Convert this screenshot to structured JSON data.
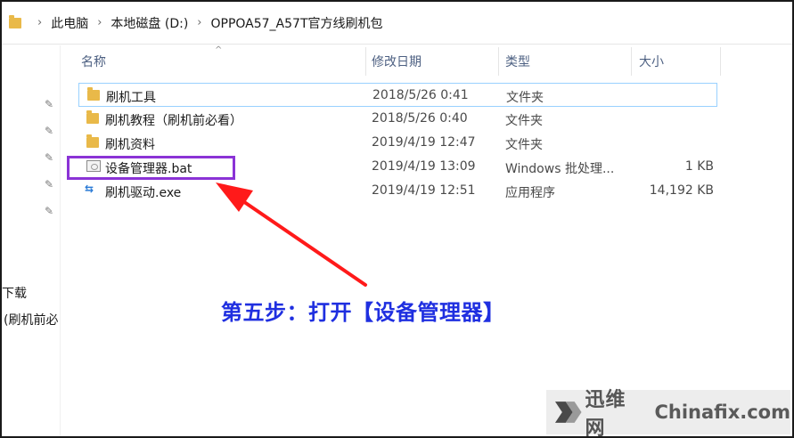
{
  "address_bar": {
    "crumbs": [
      "此电脑",
      "本地磁盘 (D:)",
      "OPPOA57_A57T官方线刷机包"
    ]
  },
  "nav": {
    "items": [
      "下载",
      "(刷机前必"
    ]
  },
  "columns": {
    "name": "名称",
    "date": "修改日期",
    "type": "类型",
    "size": "大小"
  },
  "files": [
    {
      "name": "刷机工具",
      "date": "2018/5/26 0:41",
      "type": "文件夹",
      "size": "",
      "icon": "folder-icon"
    },
    {
      "name": "刷机教程（刷机前必看）",
      "date": "2018/5/26 0:40",
      "type": "文件夹",
      "size": "",
      "icon": "folder-icon"
    },
    {
      "name": "刷机资料",
      "date": "2019/4/19 12:47",
      "type": "文件夹",
      "size": "",
      "icon": "folder-icon"
    },
    {
      "name": "设备管理器.bat",
      "date": "2019/4/19 13:09",
      "type": "Windows 批处理...",
      "size": "1 KB",
      "icon": "batch-file-icon"
    },
    {
      "name": "刷机驱动.exe",
      "date": "2019/4/19 12:51",
      "type": "应用程序",
      "size": "14,192 KB",
      "icon": "usb-exe-icon"
    }
  ],
  "annotation": {
    "step_text": "第五步：打开【设备管理器】",
    "arrow_color": "#ff1a1a",
    "box_color": "#8b33d6",
    "text_color": "#1f2fe0"
  },
  "watermark": {
    "cn": "迅维网",
    "en": "Chinafix.com"
  }
}
